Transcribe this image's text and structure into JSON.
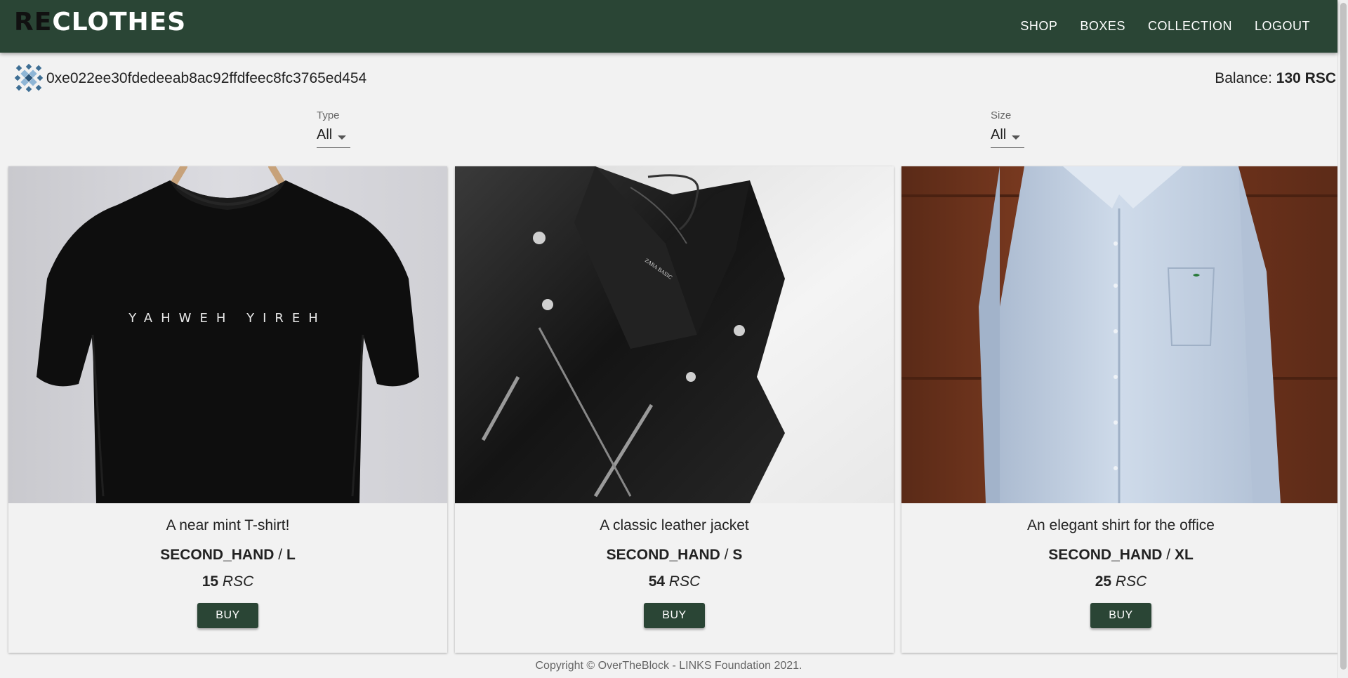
{
  "header": {
    "logo_prefix": "RE",
    "logo_rest": "CLOTHES",
    "nav": [
      {
        "label": "SHOP"
      },
      {
        "label": "BOXES"
      },
      {
        "label": "COLLECTION"
      },
      {
        "label": "LOGOUT"
      }
    ],
    "background_color": "#2a4535"
  },
  "account": {
    "address": "0xe022ee30fdedeeab8ac92ffdfeec8fc3765ed454",
    "balance_label": "Balance:",
    "balance_value": "130 RSC"
  },
  "filters": {
    "type": {
      "label": "Type",
      "value": "All"
    },
    "size": {
      "label": "Size",
      "value": "All"
    }
  },
  "products": [
    {
      "title": "A near mint T-shirt!",
      "condition": "SECOND_HAND",
      "separator": "/",
      "size": "L",
      "price": "15",
      "currency": "RSC",
      "buy_label": "BUY",
      "print_text": "YAHWEH YIREH"
    },
    {
      "title": "A classic leather jacket",
      "condition": "SECOND_HAND",
      "separator": "/",
      "size": "S",
      "price": "54",
      "currency": "RSC",
      "buy_label": "BUY",
      "print_text": "ZARA BASIC"
    },
    {
      "title": "An elegant shirt for the office",
      "condition": "SECOND_HAND",
      "separator": "/",
      "size": "XL",
      "price": "25",
      "currency": "RSC",
      "buy_label": "BUY"
    }
  ],
  "footer": {
    "text": "Copyright © OverTheBlock - LINKS Foundation 2021."
  }
}
